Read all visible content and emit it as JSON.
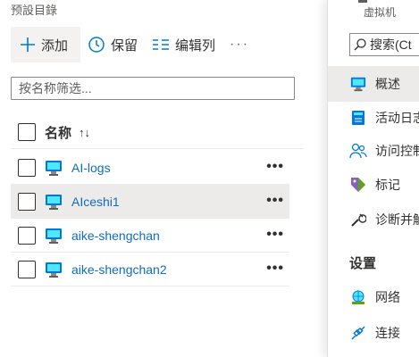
{
  "breadcrumb": "预設目錄",
  "toolbar": {
    "add_label": "添加",
    "preserve_label": "保留",
    "edit_columns_label": "编辑列",
    "more_label": "···"
  },
  "filter": {
    "placeholder": "按名称筛选..."
  },
  "table": {
    "header": {
      "name": "名称",
      "sort_glyph": "↑↓"
    },
    "rows": [
      {
        "name": "AI-logs",
        "icon": "virtual-machine-icon"
      },
      {
        "name": "AIceshi1",
        "icon": "virtual-machine-icon"
      },
      {
        "name": "aike-shengchan",
        "icon": "virtual-machine-icon"
      },
      {
        "name": "aike-shengchan2",
        "icon": "virtual-machine-icon"
      }
    ],
    "selected_row": 1,
    "row_more": "•••"
  },
  "right_panel": {
    "resource_type": "虚拟机",
    "search_placeholder": "搜索(Ct",
    "nav": [
      {
        "label": "概述",
        "icon": "virtual-machine-icon",
        "active": true
      },
      {
        "label": "活动日志",
        "icon": "activity-log-icon"
      },
      {
        "label": "访问控制",
        "icon": "access-control-icon"
      },
      {
        "label": "标记",
        "icon": "tag-icon"
      },
      {
        "label": "诊断并解",
        "icon": "wrench-icon"
      }
    ],
    "section_settings": "设置",
    "settings_nav": [
      {
        "label": "网络",
        "icon": "network-icon"
      },
      {
        "label": "连接",
        "icon": "connect-icon"
      }
    ]
  },
  "colors": {
    "link": "#0f6cbd",
    "accent": "#0078d4",
    "selected_bg": "#edebe9"
  }
}
